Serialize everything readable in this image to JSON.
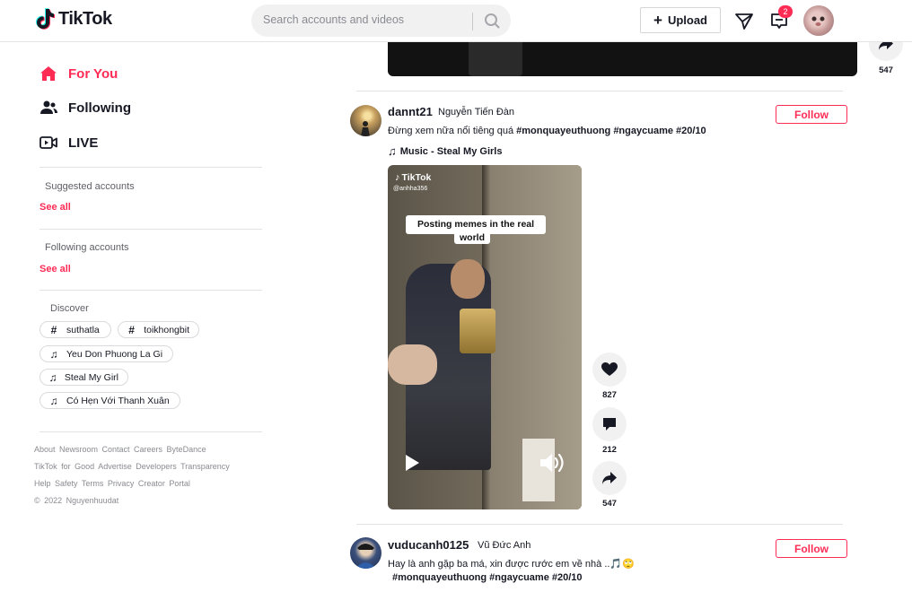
{
  "header": {
    "logo_text": "TikTok",
    "search_placeholder": "Search accounts and videos",
    "upload_label": "Upload",
    "inbox_badge": "2"
  },
  "sidebar": {
    "nav": [
      {
        "label": "For You",
        "icon": "home-icon",
        "active": true
      },
      {
        "label": "Following",
        "icon": "users-icon",
        "active": false
      },
      {
        "label": "LIVE",
        "icon": "live-camera-icon",
        "active": false
      }
    ],
    "suggested_title": "Suggested accounts",
    "suggested_see_all": "See all",
    "following_title": "Following accounts",
    "following_see_all": "See all",
    "discover_title": "Discover",
    "discover_tags": [
      {
        "type": "hashtag",
        "label": "suthatla"
      },
      {
        "type": "hashtag",
        "label": "toikhongbit"
      },
      {
        "type": "music",
        "label": "Yeu Don Phuong La Gi"
      },
      {
        "type": "music",
        "label": "Steal My Girl"
      },
      {
        "type": "music",
        "label": "Có Hẹn Với Thanh Xuân"
      }
    ],
    "footer_lines": [
      "About Newsroom Contact Careers ByteDance",
      "TikTok for Good Advertise Developers Transparency",
      "Help Safety Terms Privacy Creator Portal",
      "© 2022 Nguyenhuudat"
    ]
  },
  "feed": {
    "prev_post": {
      "share_count": "547"
    },
    "post1": {
      "username": "dannt21",
      "nickname": "Nguyễn Tiến Đàn",
      "caption_text": "Đừng xem nữa nổi tiêng quá ",
      "hashtags": "#monquayeuthuong #ngaycuame #20/10",
      "music": "Music - Steal My Girls",
      "follow_label": "Follow",
      "video": {
        "watermark": "TikTok",
        "watermark_handle": "@anhha356",
        "meme_line1": "Posting memes in the real",
        "meme_line2": "world"
      },
      "likes": "827",
      "comments": "212",
      "shares": "547"
    },
    "post2": {
      "username": "vuducanh0125",
      "nickname": "Vũ Đức Anh",
      "caption_text": "Hay là anh gặp ba má, xin được rước em về nhà ..🎵🙄",
      "hashtags": "#monquayeuthuong #ngaycuame #20/10",
      "follow_label": "Follow"
    }
  },
  "colors": {
    "accent": "#fe2c55",
    "text": "#161823",
    "muted": "#8a8b91"
  }
}
